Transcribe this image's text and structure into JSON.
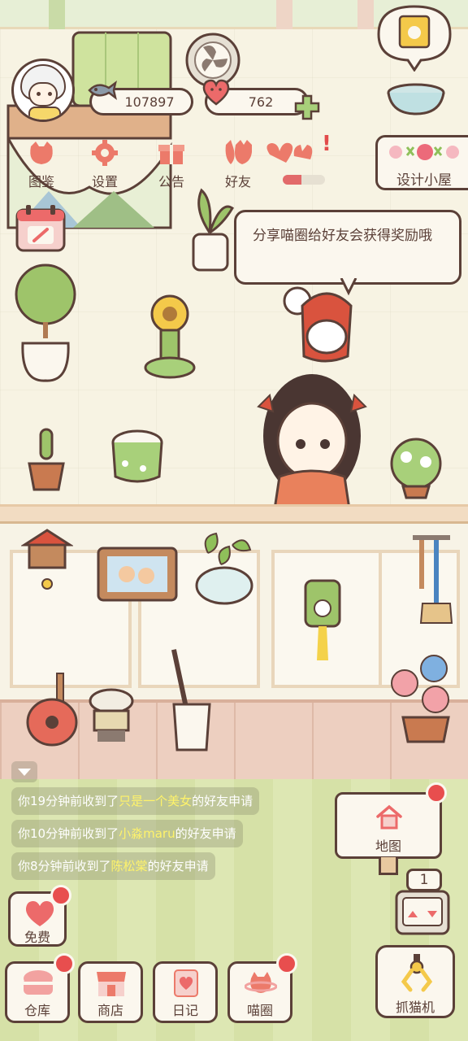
{
  "header": {
    "fish_count": "107897",
    "heart_count": "762",
    "notify_mark": "!"
  },
  "top_menu": {
    "items": [
      {
        "label": "图鉴",
        "icon": "cat-head-icon"
      },
      {
        "label": "设置",
        "icon": "gear-icon"
      },
      {
        "label": "公告",
        "icon": "gift-icon"
      },
      {
        "label": "好友",
        "icon": "friends-icon"
      }
    ],
    "mail_progress": 0.45
  },
  "design_button": {
    "label": "设计小屋"
  },
  "speech_bubble": {
    "text": "分享喵圈给好友会获得奖励哦"
  },
  "messages": [
    {
      "prefix": "你19分钟前收到了",
      "name": "只是一个美女",
      "suffix": "的好友申请"
    },
    {
      "prefix": "你10分钟前收到了",
      "name": "小淼maru",
      "suffix": "的好友申请"
    },
    {
      "prefix": "你8分钟前收到了",
      "name": "陈松棠",
      "suffix": "的好友申请"
    }
  ],
  "map_button": {
    "label": "地图"
  },
  "claw": {
    "counter": "1",
    "label": "抓猫机"
  },
  "bottom_buttons": {
    "free": "免费",
    "warehouse": "仓库",
    "shop": "商店",
    "diary": "日记",
    "cat_circle": "喵圈"
  },
  "colors": {
    "outline": "#5b4038",
    "accent_red": "#e84e4e",
    "panel": "#fbf7ee",
    "grass": "#d6e1a7",
    "wall": "#f7f3e3",
    "highlight_text": "#fff36a"
  }
}
